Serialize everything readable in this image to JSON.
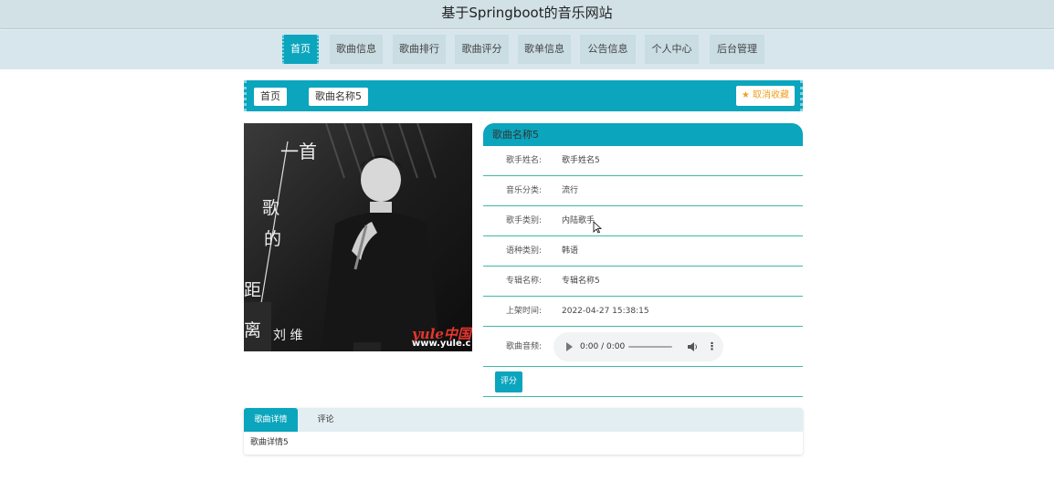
{
  "site": {
    "title": "基于Springboot的音乐网站"
  },
  "nav": {
    "items": [
      {
        "label": "首页",
        "active": true
      },
      {
        "label": "歌曲信息",
        "active": false
      },
      {
        "label": "歌曲排行",
        "active": false
      },
      {
        "label": "歌曲评分",
        "active": false
      },
      {
        "label": "歌单信息",
        "active": false
      },
      {
        "label": "公告信息",
        "active": false
      },
      {
        "label": "个人中心",
        "active": false
      },
      {
        "label": "后台管理",
        "active": false
      }
    ]
  },
  "breadcrumb": {
    "home": "首页",
    "current": "歌曲名称5",
    "favorite_label": "★ 取消收藏"
  },
  "cover": {
    "text_lines": [
      "一首",
      "歌",
      "的",
      "距",
      "离",
      "刘 维"
    ],
    "watermark": "yule中国",
    "watermark_url": "www.yule.c"
  },
  "song": {
    "name": "歌曲名称5",
    "fields": [
      {
        "key": "歌手姓名:",
        "value": "歌手姓名5"
      },
      {
        "key": "音乐分类:",
        "value": "流行"
      },
      {
        "key": "歌手类别:",
        "value": "内陆歌手"
      },
      {
        "key": "语种类别:",
        "value": "韩语"
      },
      {
        "key": "专辑名称:",
        "value": "专辑名称5"
      },
      {
        "key": "上架时间:",
        "value": "2022-04-27 15:38:15"
      }
    ],
    "audio_label": "歌曲音频:",
    "audio_time": "0:00 / 0:00",
    "rate_label": "评分"
  },
  "tabs": {
    "items": [
      {
        "label": "歌曲详情",
        "active": true
      },
      {
        "label": "评论",
        "active": false
      }
    ],
    "content": "歌曲详情5"
  },
  "colors": {
    "accent": "#0ba5bd",
    "nav_bg": "#d7e6ed",
    "title_bg": "#d1e1e6",
    "divider": "#41b8a6",
    "favorite": "#f0a020"
  }
}
